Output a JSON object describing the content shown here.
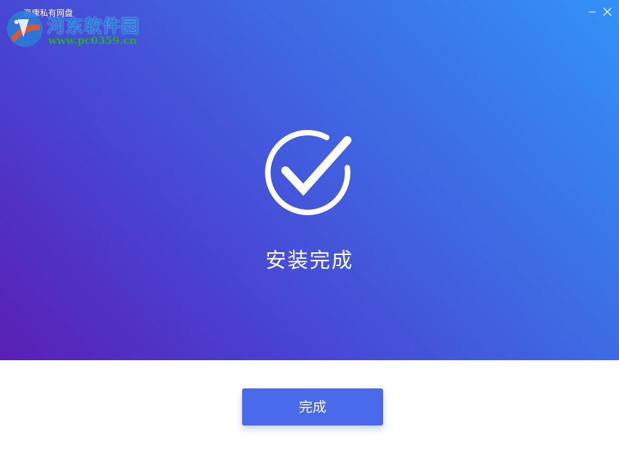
{
  "window": {
    "title": "海康私有网盘"
  },
  "watermark": {
    "name": "河东软件园",
    "url": "www.pc0359.cn"
  },
  "titlebar": {
    "minimize_icon": "minimize-icon",
    "close_icon": "close-icon"
  },
  "status": {
    "icon": "check-circle-icon",
    "message": "安装完成"
  },
  "footer": {
    "finish_label": "完成"
  },
  "colors": {
    "gradient_start": "#5a1fb4",
    "gradient_end": "#3392f6",
    "button": "#4a6aec",
    "text_on_color": "#ffffff"
  }
}
